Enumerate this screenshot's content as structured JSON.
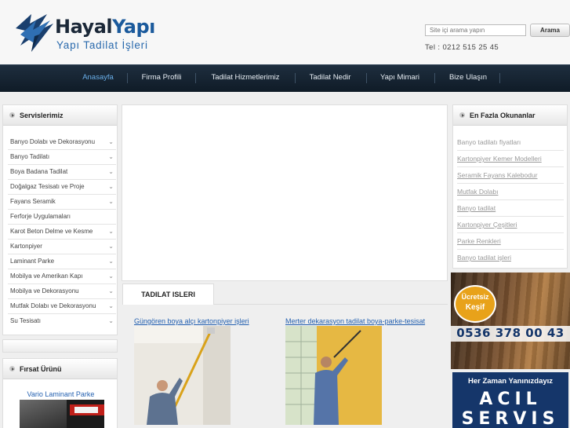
{
  "header": {
    "brand_hayal": "Hayal",
    "brand_yapi": "Yapı",
    "brand_sub": "Yapı Tadilat İşleri",
    "search_placeholder": "Site içi arama yapın",
    "search_button": "Arama",
    "phone": "Tel  : 0212 515 25 45"
  },
  "nav": {
    "items": [
      "Anasayfa",
      "Firma Profili",
      "Tadilat Hizmetlerimiz",
      "Tadilat Nedir",
      "Yapı Mimari",
      "Bize Ulaşın"
    ],
    "active_color": "#69aee8"
  },
  "services": {
    "title": "Servislerimiz",
    "items": [
      "Banyo Dolabı ve Dekorasyonu",
      "Banyo Tadilatı",
      "Boya Badana Tadilat",
      "Doğalgaz Tesisatı ve Proje",
      "Fayans Seramik",
      "Ferforje Uygulamaları",
      "Karot Beton Delme ve Kesme",
      "Kartonpiyer",
      "Laminant Parke",
      "Mobilya ve Amerikan Kapı",
      "Mobilya ve Dekorasyonu",
      "Mutfak Dolabı ve Dekorasyonu",
      "Su Tesisatı"
    ]
  },
  "deal": {
    "title": "Fırsat Ürünü",
    "product": "Vario Laminant Parke"
  },
  "most_read": {
    "title": "En Fazla Okunanlar",
    "items": [
      "Banyo tadilatı fiyatları",
      "Kartonpiyer Kemer Modelleri",
      "Seramik Fayans Kalebodur",
      "Mutfak Dolabı",
      "Banyo tadilat",
      "Kartonpiyer Çeşitleri",
      "Parke Renkleri",
      "Banyo tadilat işleri"
    ]
  },
  "ads": {
    "free_1": "Ücretsiz",
    "free_2": "Keşif",
    "ad_phone": "0536 378 00 43",
    "slogan": "Her Zaman Yanınızdayız",
    "acil": "ACIL",
    "servis": "SERVIS"
  },
  "main": {
    "tab": "TADILAT ISLERI",
    "works": [
      {
        "title": "Güngören boya alçı kartonpiyer işleri"
      },
      {
        "title": "Merter dekarasyon tadilat boya-parke-tesisat"
      }
    ]
  },
  "colors": {
    "nav_bg": "#15222f",
    "link": "#2360b0",
    "ad_orange": "#e8a21a",
    "ad_blue": "#15366a"
  }
}
